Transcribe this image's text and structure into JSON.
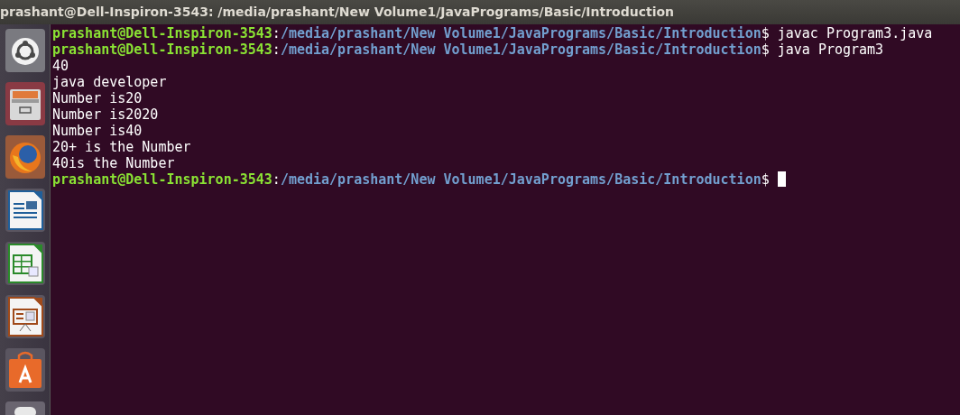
{
  "window": {
    "title": "prashant@Dell-Inspiron-3543: /media/prashant/New Volume1/JavaPrograms/Basic/Introduction"
  },
  "launcher": [
    {
      "kind": "dash"
    },
    {
      "kind": "files"
    },
    {
      "kind": "browser"
    },
    {
      "kind": "writer"
    },
    {
      "kind": "calc"
    },
    {
      "kind": "impress"
    },
    {
      "kind": "store"
    },
    {
      "kind": "partial"
    }
  ],
  "terminal": {
    "lines": [
      {
        "kind": "prompt",
        "user": "prashant@Dell-Inspiron-3543",
        "separator": ":",
        "path": "/media/prashant/New Volume1/JavaPrograms/Basic/Introduction",
        "symbol": "$",
        "command": "javac Program3.java"
      },
      {
        "kind": "prompt",
        "user": "prashant@Dell-Inspiron-3543",
        "separator": ":",
        "path": "/media/prashant/New Volume1/JavaPrograms/Basic/Introduction",
        "symbol": "$",
        "command": "java Program3"
      },
      {
        "kind": "output",
        "text": "40"
      },
      {
        "kind": "output",
        "text": "java developer"
      },
      {
        "kind": "output",
        "text": "Number is20"
      },
      {
        "kind": "output",
        "text": "Number is2020"
      },
      {
        "kind": "output",
        "text": "Number is40"
      },
      {
        "kind": "output",
        "text": "20+ is the Number"
      },
      {
        "kind": "output",
        "text": "40is the Number"
      },
      {
        "kind": "prompt",
        "user": "prashant@Dell-Inspiron-3543",
        "separator": ":",
        "path": "/media/prashant/New Volume1/JavaPrograms/Basic/Introduction",
        "symbol": "$",
        "cursor": true
      }
    ]
  }
}
